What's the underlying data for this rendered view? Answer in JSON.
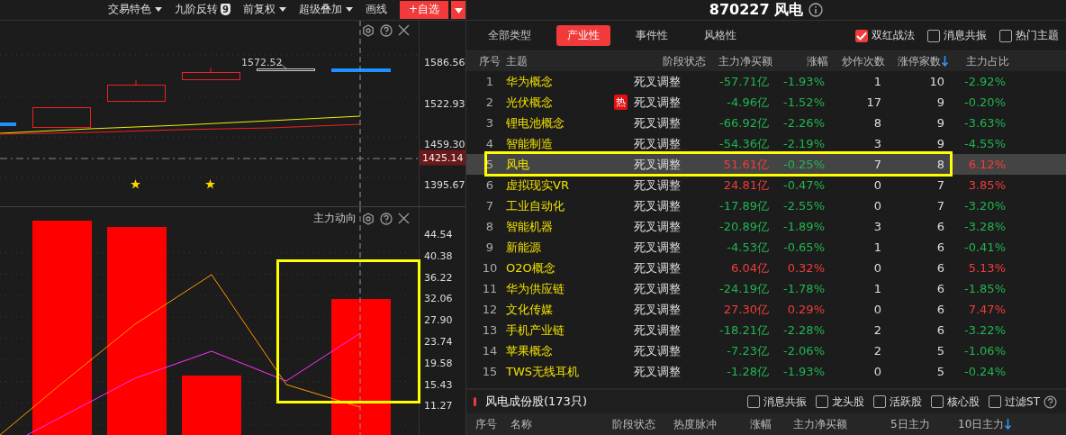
{
  "toolbar": {
    "items": [
      {
        "label": "交易特色",
        "kind": "dropdown"
      },
      {
        "label": "九阶反转",
        "kind": "badge",
        "badge": "9"
      },
      {
        "label": "前复权",
        "kind": "dropdown"
      },
      {
        "label": "超级叠加",
        "kind": "dropdown"
      },
      {
        "label": "画线",
        "kind": "plain"
      }
    ],
    "add_button": "+自选"
  },
  "price_chart": {
    "price_label": "1572.52",
    "axis": [
      "1586.56",
      "1522.93",
      "1459.30",
      "1395.67"
    ],
    "current_price": "1425.14"
  },
  "flow_chart": {
    "title": "主力动向",
    "axis": [
      "44.54",
      "40.38",
      "36.22",
      "32.06",
      "27.90",
      "23.74",
      "19.58",
      "15.43",
      "11.27"
    ]
  },
  "stock": {
    "code_name": "870227 风电"
  },
  "filter_tabs": [
    {
      "label": "全部类型",
      "selected": false
    },
    {
      "label": "产业性",
      "selected": true
    },
    {
      "label": "事件性",
      "selected": false
    },
    {
      "label": "风格性",
      "selected": false
    }
  ],
  "options": [
    {
      "label": "双红战法",
      "checked": true
    },
    {
      "label": "消息共振",
      "checked": false
    },
    {
      "label": "热门主题",
      "checked": false
    }
  ],
  "table": {
    "columns": [
      {
        "label": "序号",
        "sorted": false
      },
      {
        "label": "主题",
        "sorted": false
      },
      {
        "label": "阶段状态",
        "sorted": false
      },
      {
        "label": "主力净买额",
        "sorted": false
      },
      {
        "label": "涨幅",
        "sorted": false
      },
      {
        "label": "炒作次数",
        "sorted": false
      },
      {
        "label": "涨停家数",
        "sorted": true
      },
      {
        "label": "主力占比",
        "sorted": false
      }
    ],
    "rows": [
      {
        "no": "1",
        "theme": "华为概念",
        "stage": "死叉调整",
        "net": "-57.71亿",
        "net_up": false,
        "change": "-1.93%",
        "change_up": false,
        "count": "1",
        "limit_count": "10",
        "share": "-2.92%",
        "share_up": false,
        "selected": false
      },
      {
        "no": "2",
        "theme": "光伏概念",
        "badge": "热",
        "stage": "死叉调整",
        "net": "-4.96亿",
        "net_up": false,
        "change": "-1.52%",
        "change_up": false,
        "count": "17",
        "limit_count": "9",
        "share": "-0.20%",
        "share_up": false,
        "selected": false
      },
      {
        "no": "3",
        "theme": "锂电池概念",
        "stage": "死叉调整",
        "net": "-66.92亿",
        "net_up": false,
        "change": "-2.26%",
        "change_up": false,
        "count": "8",
        "limit_count": "9",
        "share": "-3.63%",
        "share_up": false,
        "selected": false
      },
      {
        "no": "4",
        "theme": "智能制造",
        "stage": "死叉调整",
        "net": "-54.36亿",
        "net_up": false,
        "change": "-2.19%",
        "change_up": false,
        "count": "3",
        "limit_count": "9",
        "share": "-4.55%",
        "share_up": false,
        "selected": false
      },
      {
        "no": "5",
        "theme": "风电",
        "stage": "死叉调整",
        "net": "51.61亿",
        "net_up": true,
        "change": "-0.25%",
        "change_up": false,
        "count": "7",
        "limit_count": "8",
        "share": "6.12%",
        "share_up": true,
        "selected": true
      },
      {
        "no": "6",
        "theme": "虚拟现实VR",
        "stage": "死叉调整",
        "net": "24.81亿",
        "net_up": true,
        "change": "-0.47%",
        "change_up": false,
        "count": "0",
        "limit_count": "7",
        "share": "3.85%",
        "share_up": true,
        "selected": false
      },
      {
        "no": "7",
        "theme": "工业自动化",
        "stage": "死叉调整",
        "net": "-17.89亿",
        "net_up": false,
        "change": "-2.55%",
        "change_up": false,
        "count": "0",
        "limit_count": "7",
        "share": "-3.20%",
        "share_up": false,
        "selected": false
      },
      {
        "no": "8",
        "theme": "智能机器",
        "stage": "死叉调整",
        "net": "-20.89亿",
        "net_up": false,
        "change": "-1.89%",
        "change_up": false,
        "count": "3",
        "limit_count": "6",
        "share": "-3.28%",
        "share_up": false,
        "selected": false
      },
      {
        "no": "9",
        "theme": "新能源",
        "stage": "死叉调整",
        "net": "-4.53亿",
        "net_up": false,
        "change": "-0.65%",
        "change_up": false,
        "count": "1",
        "limit_count": "6",
        "share": "-0.41%",
        "share_up": false,
        "selected": false
      },
      {
        "no": "10",
        "theme": "O2O概念",
        "stage": "死叉调整",
        "net": "6.04亿",
        "net_up": true,
        "change": "0.32%",
        "change_up": true,
        "count": "0",
        "limit_count": "6",
        "share": "5.13%",
        "share_up": true,
        "selected": false
      },
      {
        "no": "11",
        "theme": "华为供应链",
        "stage": "死叉调整",
        "net": "-24.19亿",
        "net_up": false,
        "change": "-1.78%",
        "change_up": false,
        "count": "1",
        "limit_count": "6",
        "share": "-1.85%",
        "share_up": false,
        "selected": false
      },
      {
        "no": "12",
        "theme": "文化传媒",
        "stage": "死叉调整",
        "net": "27.30亿",
        "net_up": true,
        "change": "0.29%",
        "change_up": true,
        "count": "0",
        "limit_count": "6",
        "share": "7.47%",
        "share_up": true,
        "selected": false
      },
      {
        "no": "13",
        "theme": "手机产业链",
        "stage": "死叉调整",
        "net": "-18.21亿",
        "net_up": false,
        "change": "-2.28%",
        "change_up": false,
        "count": "2",
        "limit_count": "6",
        "share": "-3.22%",
        "share_up": false,
        "selected": false
      },
      {
        "no": "14",
        "theme": "苹果概念",
        "stage": "死叉调整",
        "net": "-7.23亿",
        "net_up": false,
        "change": "-2.06%",
        "change_up": false,
        "count": "2",
        "limit_count": "5",
        "share": "-1.06%",
        "share_up": false,
        "selected": false
      },
      {
        "no": "15",
        "theme": "TWS无线耳机",
        "stage": "死叉调整",
        "net": "-1.28亿",
        "net_up": false,
        "change": "-1.93%",
        "change_up": false,
        "count": "0",
        "limit_count": "5",
        "share": "-0.24%",
        "share_up": false,
        "selected": false
      }
    ]
  },
  "components": {
    "title": "风电成份股(173只)",
    "options": [
      {
        "label": "消息共振",
        "checked": false
      },
      {
        "label": "龙头股",
        "checked": false
      },
      {
        "label": "活跃股",
        "checked": false
      },
      {
        "label": "核心股",
        "checked": false
      },
      {
        "label": "过滤ST",
        "checked": false
      }
    ],
    "columns": [
      {
        "label": "序号",
        "sorted": false
      },
      {
        "label": "名称",
        "sorted": false
      },
      {
        "label": "阶段状态",
        "sorted": false
      },
      {
        "label": "热度脉冲",
        "sorted": false
      },
      {
        "label": "涨幅",
        "sorted": false
      },
      {
        "label": "主力净买额",
        "sorted": false
      },
      {
        "label": "5日主力",
        "sorted": false
      },
      {
        "label": "10日主力",
        "sorted": true
      }
    ]
  }
}
